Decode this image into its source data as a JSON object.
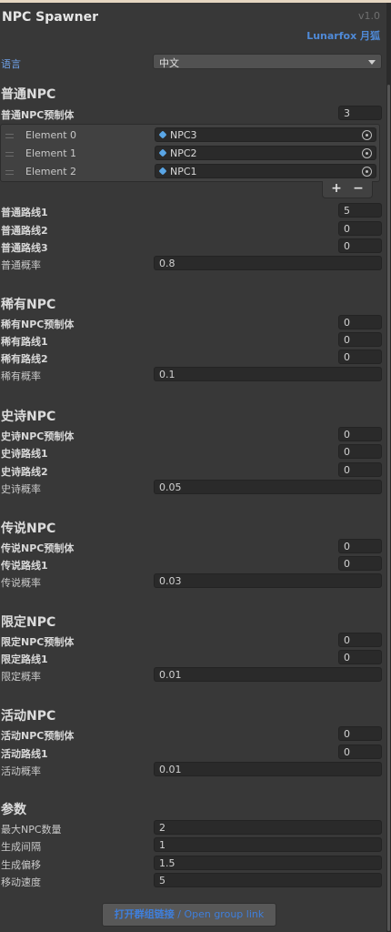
{
  "header": {
    "title": "NPC Spawner",
    "version": "v1.0",
    "author": "Lunarfox 月狐"
  },
  "language": {
    "label": "语言",
    "value": "中文"
  },
  "common": {
    "title": "普通NPC",
    "prefab_label": "普通NPC预制体",
    "prefab_count": "3",
    "elements": [
      {
        "label": "Element 0",
        "value": "NPC3"
      },
      {
        "label": "Element 1",
        "value": "NPC2"
      },
      {
        "label": "Element 2",
        "value": "NPC1"
      }
    ],
    "add_label": "+",
    "remove_label": "−",
    "routes": [
      {
        "label": "普通路线1",
        "value": "5"
      },
      {
        "label": "普通路线2",
        "value": "0"
      },
      {
        "label": "普通路线3",
        "value": "0"
      }
    ],
    "prob_label": "普通概率",
    "prob_value": "0.8"
  },
  "rare": {
    "title": "稀有NPC",
    "prefab_label": "稀有NPC预制体",
    "prefab_count": "0",
    "routes": [
      {
        "label": "稀有路线1",
        "value": "0"
      },
      {
        "label": "稀有路线2",
        "value": "0"
      }
    ],
    "prob_label": "稀有概率",
    "prob_value": "0.1"
  },
  "epic": {
    "title": "史诗NPC",
    "prefab_label": "史诗NPC预制体",
    "prefab_count": "0",
    "routes": [
      {
        "label": "史诗路线1",
        "value": "0"
      },
      {
        "label": "史诗路线2",
        "value": "0"
      }
    ],
    "prob_label": "史诗概率",
    "prob_value": "0.05"
  },
  "legend": {
    "title": "传说NPC",
    "prefab_label": "传说NPC预制体",
    "prefab_count": "0",
    "routes": [
      {
        "label": "传说路线1",
        "value": "0"
      }
    ],
    "prob_label": "传说概率",
    "prob_value": "0.03"
  },
  "limited": {
    "title": "限定NPC",
    "prefab_label": "限定NPC预制体",
    "prefab_count": "0",
    "routes": [
      {
        "label": "限定路线1",
        "value": "0"
      }
    ],
    "prob_label": "限定概率",
    "prob_value": "0.01"
  },
  "event": {
    "title": "活动NPC",
    "prefab_label": "活动NPC预制体",
    "prefab_count": "0",
    "routes": [
      {
        "label": "活动路线1",
        "value": "0"
      }
    ],
    "prob_label": "活动概率",
    "prob_value": "0.01"
  },
  "params": {
    "title": "参数",
    "items": [
      {
        "label": "最大NPC数量",
        "value": "2"
      },
      {
        "label": "生成间隔",
        "value": "1"
      },
      {
        "label": "生成偏移",
        "value": "1.5"
      },
      {
        "label": "移动速度",
        "value": "5"
      }
    ]
  },
  "footer": {
    "button_bold": "打开群组链接",
    "button_rest": " / Open group link"
  },
  "colors": {
    "background": "#383838",
    "field": "#2a2a2a",
    "accent": "#4f8ad8"
  }
}
